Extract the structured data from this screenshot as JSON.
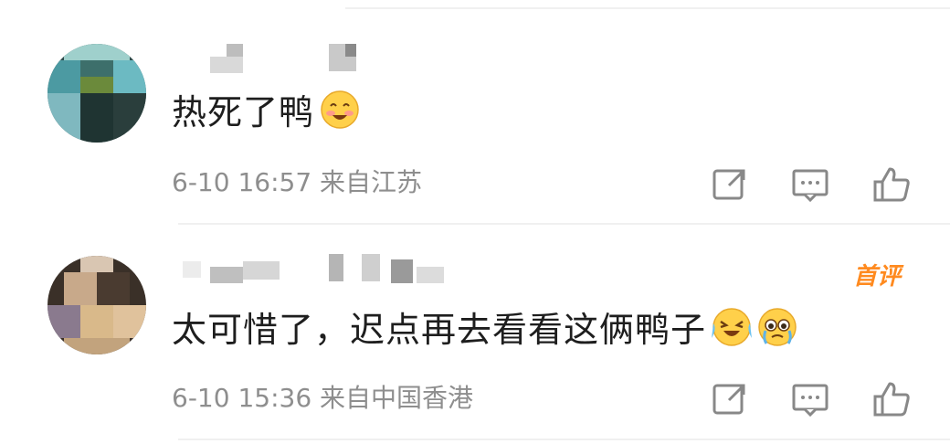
{
  "comments": [
    {
      "text": "热死了鸭",
      "emojis": [
        "smiling-blush-emoji"
      ],
      "meta": "6-10 16:57 来自江苏",
      "actions": [
        "share-icon",
        "reply-icon",
        "like-icon"
      ]
    },
    {
      "text": "太可惜了，迟点再去看看这俩鸭子",
      "badge": "首评",
      "emojis": [
        "crying-laughing-emoji",
        "teary-eyes-emoji"
      ],
      "meta": "6-10 15:36 来自中国香港",
      "actions": [
        "share-icon",
        "reply-icon",
        "like-icon"
      ]
    }
  ],
  "colors": {
    "meta_text": "#8e8e8e",
    "badge": "#ff8a1f",
    "divider": "#f0f0f0",
    "icon": "#888888"
  }
}
